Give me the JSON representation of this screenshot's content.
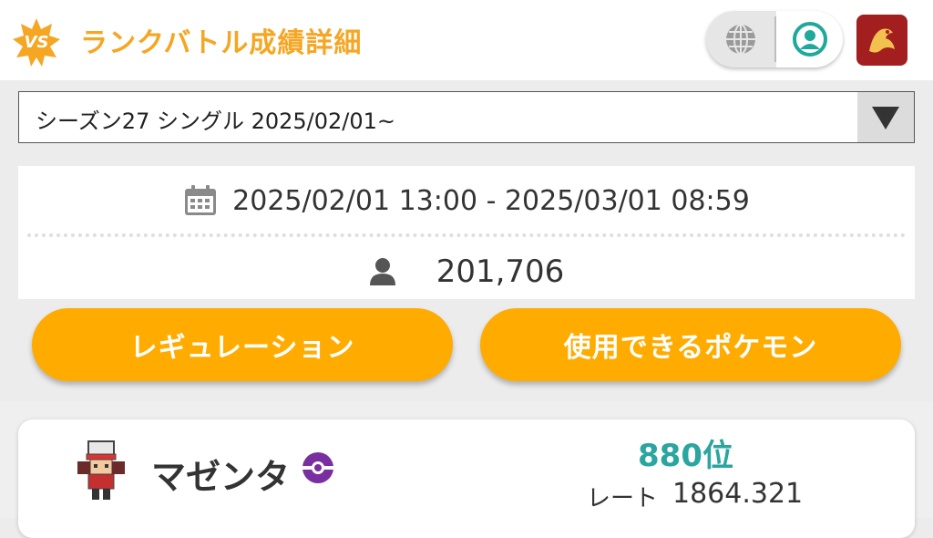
{
  "header": {
    "badge_text": "VS",
    "title": "ランクバトル成績詳細",
    "accent_color": "#f5a623",
    "icons": {
      "globe": "globe-icon",
      "account": "account-icon",
      "app": "app-icon"
    }
  },
  "season_select": {
    "selected": "シーズン27 シングル 2025/02/01~"
  },
  "info": {
    "date_range": "2025/02/01 13:00 - 2025/03/01 08:59",
    "players": "201,706"
  },
  "buttons": {
    "regulation": "レギュレーション",
    "usable_pokemon": "使用できるポケモン",
    "color": "#ffab00"
  },
  "player": {
    "name": "マゼンタ",
    "rank": "880位",
    "rate_label": "レート",
    "rate_value": "1864.321",
    "rank_color": "#2aa5a0"
  }
}
